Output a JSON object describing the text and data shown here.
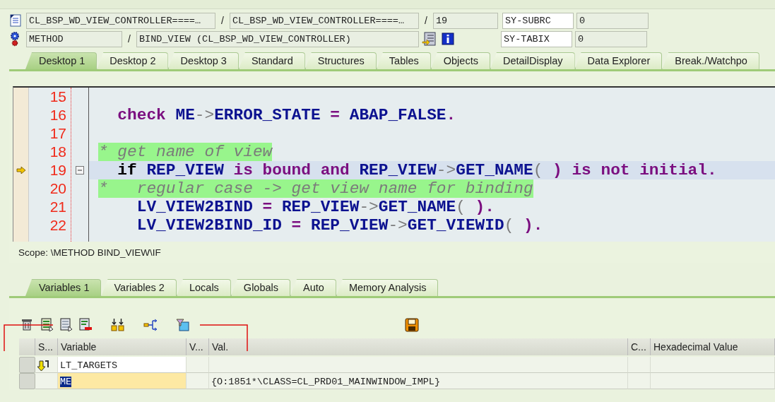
{
  "program_row": {
    "program": "CL_BSP_WD_VIEW_CONTROLLER====…",
    "separator_1": "/",
    "include": "CL_BSP_WD_VIEW_CONTROLLER====…",
    "separator_2": "/",
    "line": "19"
  },
  "event_row": {
    "event_type": "METHOD",
    "separator": "/",
    "event": "BIND_VIEW (CL_BSP_WD_VIEW_CONTROLLER)"
  },
  "system_fields": [
    {
      "name": "SY-SUBRC",
      "value": "0"
    },
    {
      "name": "SY-TABIX",
      "value": "0"
    }
  ],
  "tabs": [
    {
      "label": "Desktop 1",
      "selected": true
    },
    {
      "label": "Desktop 2",
      "selected": false
    },
    {
      "label": "Desktop 3",
      "selected": false
    },
    {
      "label": "Standard",
      "selected": false
    },
    {
      "label": "Structures",
      "selected": false
    },
    {
      "label": "Tables",
      "selected": false
    },
    {
      "label": "Objects",
      "selected": false
    },
    {
      "label": "DetailDisplay",
      "selected": false
    },
    {
      "label": "Data Explorer",
      "selected": false
    },
    {
      "label": "Break./Watchpo",
      "selected": false
    }
  ],
  "code_lines": [
    {
      "number": "15",
      "current": false,
      "foldable": false
    },
    {
      "number": "16",
      "current": false,
      "foldable": false,
      "tokens": [
        {
          "text": "  check",
          "kind": "keyword"
        },
        {
          "text": " ME",
          "kind": "name"
        },
        {
          "text": "->",
          "kind": "operator"
        },
        {
          "text": "ERROR_STATE",
          "kind": "name"
        },
        {
          "text": " = ",
          "kind": "punct"
        },
        {
          "text": "ABAP_FALSE",
          "kind": "name"
        },
        {
          "text": ".",
          "kind": "punct"
        }
      ]
    },
    {
      "number": "17",
      "current": false,
      "foldable": false
    },
    {
      "number": "18",
      "current": false,
      "foldable": false,
      "tokens": [
        {
          "text": "* get name of view",
          "kind": "comment"
        }
      ]
    },
    {
      "number": "19",
      "current": true,
      "foldable": true,
      "tokens": [
        {
          "text": "  if",
          "kind": "control"
        },
        {
          "text": " REP_VIEW",
          "kind": "name"
        },
        {
          "text": " is bound and ",
          "kind": "keyword"
        },
        {
          "text": "REP_VIEW",
          "kind": "name"
        },
        {
          "text": "->",
          "kind": "operator"
        },
        {
          "text": "GET_NAME",
          "kind": "name"
        },
        {
          "text": "( ",
          "kind": "operator"
        },
        {
          "text": ")",
          "kind": "punct"
        },
        {
          "text": " is not initial.",
          "kind": "keyword"
        }
      ]
    },
    {
      "number": "20",
      "current": false,
      "foldable": false,
      "tokens": [
        {
          "text": "*   regular case -> get view name for binding",
          "kind": "comment"
        }
      ]
    },
    {
      "number": "21",
      "current": false,
      "foldable": false,
      "tokens": [
        {
          "text": "    LV_VIEW2BIND",
          "kind": "name"
        },
        {
          "text": " = ",
          "kind": "punct"
        },
        {
          "text": "REP_VIEW",
          "kind": "name"
        },
        {
          "text": "->",
          "kind": "operator"
        },
        {
          "text": "GET_NAME",
          "kind": "name"
        },
        {
          "text": "( ",
          "kind": "operator"
        },
        {
          "text": ").",
          "kind": "punct"
        }
      ]
    },
    {
      "number": "22",
      "current": false,
      "foldable": false,
      "tokens": [
        {
          "text": "    LV_VIEW2BIND_ID",
          "kind": "name"
        },
        {
          "text": " = ",
          "kind": "punct"
        },
        {
          "text": "REP_VIEW",
          "kind": "name"
        },
        {
          "text": "->",
          "kind": "operator"
        },
        {
          "text": "GET_VIEWID",
          "kind": "name"
        },
        {
          "text": "( ",
          "kind": "operator"
        },
        {
          "text": ").",
          "kind": "punct"
        }
      ]
    }
  ],
  "scope": "Scope: \\METHOD BIND_VIEW\\IF",
  "variable_tabs": [
    {
      "label": "Variables 1",
      "selected": true
    },
    {
      "label": "Variables 2",
      "selected": false
    },
    {
      "label": "Locals",
      "selected": false
    },
    {
      "label": "Globals",
      "selected": false
    },
    {
      "label": "Auto",
      "selected": false
    },
    {
      "label": "Memory Analysis",
      "selected": false
    }
  ],
  "variables_table": {
    "columns": [
      "S...",
      "Variable",
      "V...",
      "Val.",
      "C...",
      "Hexadecimal Value"
    ],
    "rows": [
      {
        "status_icon": true,
        "variable": "LT_TARGETS",
        "selected": false
      },
      {
        "status_icon": false,
        "variable": "ME",
        "value": "{O:1851*\\CLASS=CL_PRD01_MAINWINDOW_IMPL}",
        "selected": true
      }
    ]
  }
}
